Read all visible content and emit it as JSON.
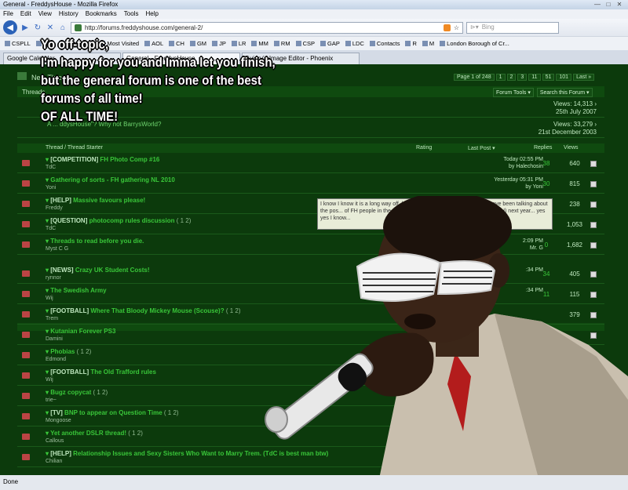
{
  "window": {
    "title": "General - FreddysHouse - Mozilla Firefox",
    "buttons": [
      "—",
      "□",
      "✕"
    ]
  },
  "menu": [
    "File",
    "Edit",
    "View",
    "History",
    "Bookmarks",
    "Tools",
    "Help"
  ],
  "nav": {
    "url": "http://forums.freddyshouse.com/general-2/",
    "search_placeholder": "Bing"
  },
  "bookmarks": [
    "CSPLL",
    "RIG",
    "Categories",
    "Most Visited",
    "AOL",
    "CH",
    "GM",
    "JP",
    "LR",
    "MM",
    "RM",
    "CSP",
    "GAP",
    "LDC",
    "Contacts",
    "R",
    "M",
    "London Borough of Cr..."
  ],
  "tabs": [
    {
      "label": "Google Calendar"
    },
    {
      "label": "General - FreddysHouse",
      "active": true
    },
    {
      "label": "Aviary's Image Editor - Phoenix"
    }
  ],
  "forum": {
    "new_thread": "New Thread",
    "threads_label": "Threads",
    "pagination": [
      "Page 1 of 248",
      "1",
      "2",
      "3",
      "11",
      "51",
      "101",
      "Last »"
    ],
    "tools": [
      "Forum Tools ▾",
      "Search this Forum ▾"
    ],
    "announcements": [
      {
        "title": "",
        "views": "Views: 14,313 ›",
        "date": "25th July 2007"
      },
      {
        "title": "A ... ddysHouse\"? Why not BarrysWorld?",
        "views": "Views: 33,279 ›",
        "date": "21st December 2003"
      }
    ],
    "columns": {
      "thread": "Thread / Thread Starter",
      "rating": "Rating",
      "last_post": "Last Post ▾",
      "replies": "Replies",
      "views": "Views"
    },
    "threads": [
      {
        "prefix": "[COMPETITION]",
        "title": "FH Photo Comp #16",
        "pages": "",
        "author": "TdC",
        "last": "Today 02:55 PM",
        "by": "by Halechosin",
        "replies": "38",
        "views": "640"
      },
      {
        "prefix": "",
        "title": "Gathering of sorts - FH gathering NL 2010",
        "pages": "",
        "author": "Yoni",
        "last": "Yesterday 05:31 PM",
        "by": "by Yoni",
        "replies": "30",
        "views": "815"
      },
      {
        "prefix": "[HELP]",
        "title": "Massive favours please!",
        "pages": "",
        "author": "Freddy",
        "last": "",
        "by": "",
        "replies": "",
        "views": "238"
      },
      {
        "prefix": "[QUESTION]",
        "title": "photocomp rules discussion",
        "pages": "( 1 2)",
        "author": "TdC",
        "last": "",
        "by": "",
        "replies": "",
        "views": "1,053"
      },
      {
        "prefix": "",
        "title": "Threads to read before you die.",
        "pages": "",
        "author": "Myst C G",
        "last": "2:09 PM",
        "by": "Mr. G",
        "replies": "0",
        "views": "1,682"
      }
    ],
    "threads2": [
      {
        "prefix": "[NEWS]",
        "title": "Crazy UK Student Costs!",
        "pages": "",
        "author": "rynnor",
        "last": ":34 PM",
        "by": "",
        "replies": "34",
        "views": "405"
      },
      {
        "prefix": "",
        "title": "The Swedish Army",
        "pages": "",
        "author": "Wij",
        "last": ":34 PM",
        "by": "",
        "replies": "11",
        "views": "115"
      },
      {
        "prefix": "[FOOTBALL]",
        "title": "Where That Bloody Mickey Mouse (Scouse)?",
        "pages": "( 1 2)",
        "author": "Trem",
        "last": "",
        "by": "",
        "replies": "",
        "views": "379"
      },
      {
        "prefix": "",
        "title": "Kutanian Forever PS3",
        "pages": "",
        "author": "Damini",
        "last": "",
        "by": "",
        "replies": "",
        "views": ""
      },
      {
        "prefix": "",
        "title": "Phobias",
        "pages": "( 1 2)",
        "author": "Edmond",
        "last": "",
        "by": "",
        "replies": "",
        "views": ""
      },
      {
        "prefix": "[FOOTBALL]",
        "title": "The Old Trafford rules",
        "pages": "",
        "author": "Wij",
        "last": "",
        "by": "",
        "replies": "",
        "views": ""
      },
      {
        "prefix": "",
        "title": "Bugz copycat",
        "pages": "( 1 2)",
        "author": "trie~",
        "last": "",
        "by": "",
        "replies": "",
        "views": ""
      },
      {
        "prefix": "[TV]",
        "title": "BNP to appear on Question Time",
        "pages": "( 1 2)",
        "author": "Mongoose",
        "last": "",
        "by": "",
        "replies": "",
        "views": ""
      },
      {
        "prefix": "",
        "title": "Yet another DSLR thread!",
        "pages": "( 1 2)",
        "author": "Callous",
        "last": "",
        "by": "",
        "replies": "",
        "views": ""
      },
      {
        "prefix": "[HELP]",
        "title": "Relationship Issues and Sexy Sisters Who Want to Marry Trem. (TdC is best man btw)",
        "pages": "",
        "author": "Chilian",
        "last": "",
        "by": "",
        "replies": "",
        "views": ""
      }
    ],
    "tooltip": "I know I know it is a long way off, ho... there is much to do. TdC and I have been talking about the pos... of FH people in the Netherlands and thought it p... birthday (BLAH) next year... yes yes I know..."
  },
  "meme": {
    "caption": [
      "Yo off-topic,",
      "I'm happy for you and Imma let you finish,",
      "but the general forum is one of the best",
      "forums of all time!",
      "OF ALL TIME!"
    ]
  },
  "status": "Done"
}
